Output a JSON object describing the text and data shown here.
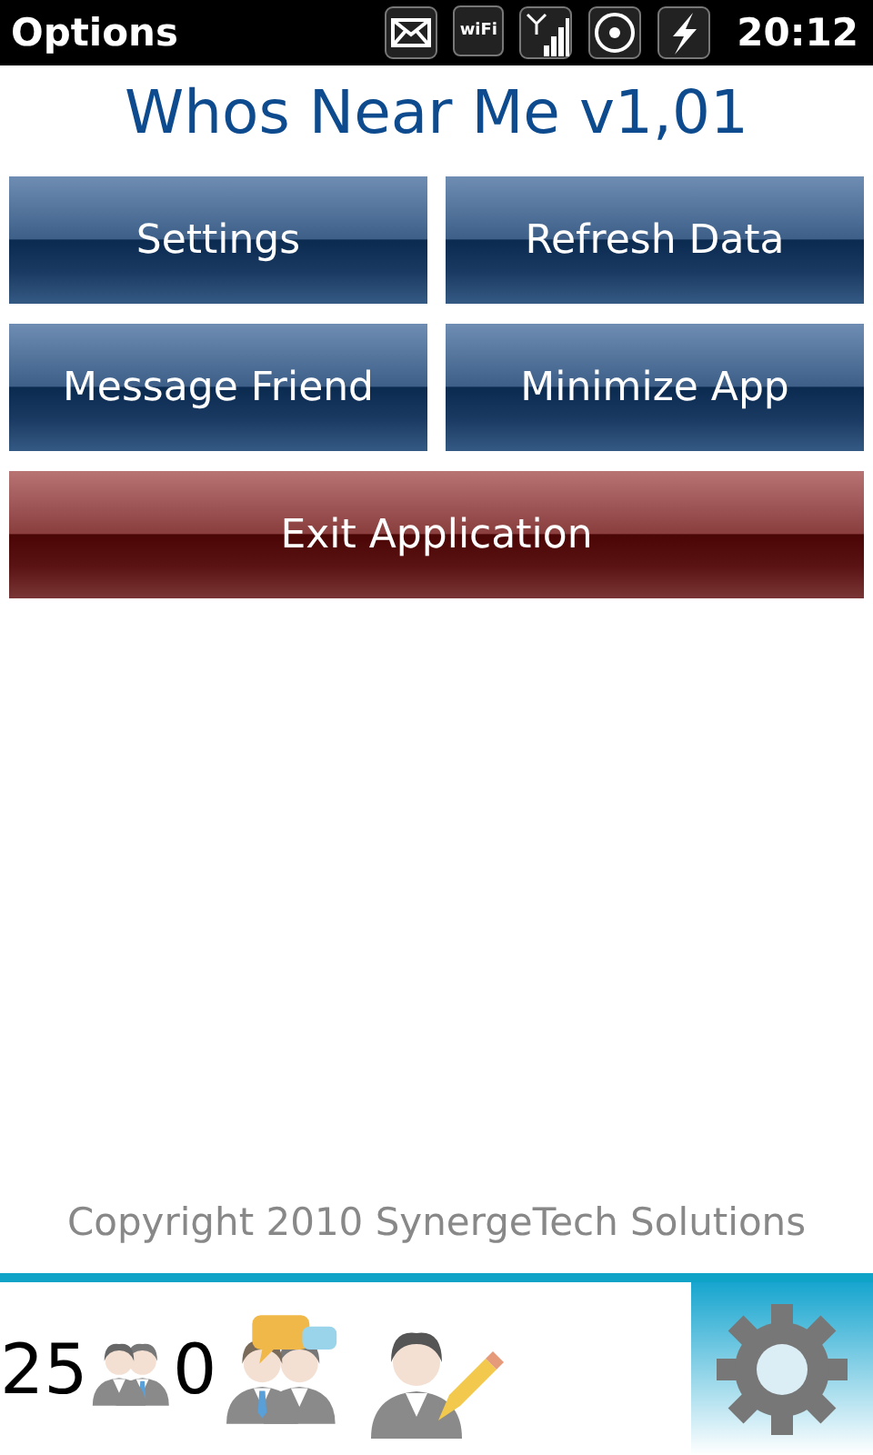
{
  "status_bar": {
    "title": "Options",
    "time": "20:12",
    "icons": [
      {
        "kind": "mail"
      },
      {
        "kind": "wifi",
        "label": "wiFi"
      },
      {
        "kind": "signal"
      },
      {
        "kind": "speaker"
      },
      {
        "kind": "power"
      }
    ]
  },
  "app_title": "Whos Near Me v1,01",
  "buttons": [
    {
      "label": "Settings",
      "kind": "blue"
    },
    {
      "label": "Refresh Data",
      "kind": "blue"
    },
    {
      "label": "Message Friend",
      "kind": "blue"
    },
    {
      "label": "Minimize App",
      "kind": "blue"
    },
    {
      "label": "Exit Application",
      "kind": "red"
    }
  ],
  "copyright": "Copyright 2010 SynergeTech Solutions",
  "toolbar": [
    {
      "kind": "people",
      "count": "25"
    },
    {
      "kind": "chat",
      "count": "0"
    },
    {
      "kind": "edit"
    },
    {
      "kind": "gear",
      "selected": true
    }
  ]
}
